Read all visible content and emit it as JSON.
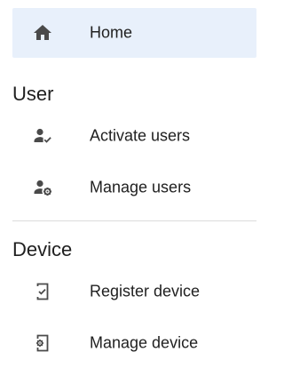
{
  "nav": {
    "home": {
      "label": "Home",
      "icon": "home-icon",
      "selected": true
    },
    "sections": [
      {
        "title": "User",
        "items": [
          {
            "label": "Activate users",
            "icon": "user-check-icon"
          },
          {
            "label": "Manage users",
            "icon": "user-gear-icon"
          }
        ]
      },
      {
        "title": "Device",
        "items": [
          {
            "label": "Register device",
            "icon": "device-check-icon"
          },
          {
            "label": "Manage device",
            "icon": "device-gear-icon"
          }
        ]
      }
    ]
  },
  "colors": {
    "selected_bg": "#e8f0fb",
    "icon": "#4a4a4a",
    "text": "#212121",
    "divider": "#dcdcdc"
  }
}
